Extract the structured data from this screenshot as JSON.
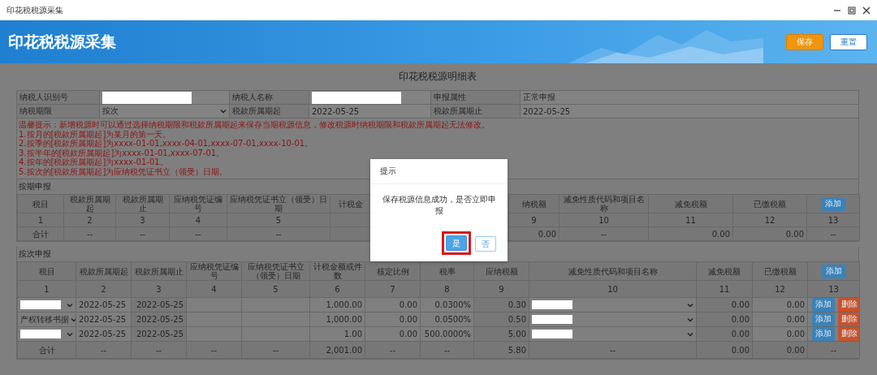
{
  "window": {
    "title": "印花税税源采集"
  },
  "header": {
    "title": "印花税税源采集",
    "buttons": [
      {
        "label": "保存",
        "kind": "primary"
      },
      {
        "label": "重置",
        "kind": "secondary"
      }
    ]
  },
  "page_title": "印花税税源明细表",
  "form": {
    "rows": [
      [
        {
          "label": "纳税人识别号",
          "kind": "input"
        },
        {
          "label": "纳税人名称",
          "kind": "input"
        },
        {
          "label": "申报属性",
          "kind": "text",
          "value": "正常申报"
        }
      ],
      [
        {
          "label": "纳税期限",
          "kind": "select",
          "value": "按次"
        },
        {
          "label": "税款所属期起",
          "kind": "text",
          "value": "2022-05-25"
        },
        {
          "label": "税款所属期止",
          "kind": "text",
          "value": "2022-05-25"
        }
      ]
    ]
  },
  "notice": [
    "温馨提示：新增税源时可以通过选择纳税期限和税款所属期起来保存当期税源信息，修改税源时纳税期限和税款所属期起无法修改。",
    "1.按月的[税款所属期起]为某月的第一天。",
    "2.按季的[税款所属期起]为xxxx-01-01,xxxx-04-01,xxxx-07-01,xxxx-10-01。",
    "3.按半年的[税款所属期起]为xxxx-01-01,xxxx-07-01。",
    "4.按年的[税款所属期起]为xxxx-01-01。",
    "5.按次的[税款所属期起]为应纳税凭证书立（领受）日期。"
  ],
  "periodic_table": {
    "title": "按期申报",
    "header": [
      {
        "kind": "text",
        "text": "税目"
      },
      {
        "kind": "text",
        "text": "税款所属期起"
      },
      {
        "kind": "text",
        "text": "税款所属期止"
      },
      {
        "kind": "text",
        "text": "应纳税凭证编号"
      },
      {
        "kind": "text",
        "text": "应纳税凭证书立（领受）日期"
      },
      {
        "kind": "text",
        "text": "计税金"
      },
      {
        "kind": "blank"
      },
      {
        "kind": "blank"
      },
      {
        "kind": "text",
        "text": "纳税额"
      },
      {
        "kind": "text",
        "text": "减免性质代码和项目名称"
      },
      {
        "kind": "text",
        "text": "减免税额"
      },
      {
        "kind": "text",
        "text": "已缴税额"
      },
      {
        "kind": "button",
        "text": "添加"
      }
    ],
    "numbers": [
      {
        "kind": "text",
        "text": "1"
      },
      {
        "kind": "text",
        "text": "2"
      },
      {
        "kind": "text",
        "text": "3"
      },
      {
        "kind": "text",
        "text": "4"
      },
      {
        "kind": "text",
        "text": "5"
      },
      {
        "kind": "blank"
      },
      {
        "kind": "blank"
      },
      {
        "kind": "blank"
      },
      {
        "kind": "text",
        "text": "9"
      },
      {
        "kind": "text",
        "text": "10"
      },
      {
        "kind": "text",
        "text": "11"
      },
      {
        "kind": "text",
        "text": "12"
      },
      {
        "kind": "text",
        "text": "13"
      }
    ],
    "total": [
      {
        "kind": "text",
        "text": "合计"
      },
      {
        "kind": "text",
        "text": "--"
      },
      {
        "kind": "text",
        "text": "--"
      },
      {
        "kind": "text",
        "text": "--"
      },
      {
        "kind": "text",
        "text": "--"
      },
      {
        "kind": "blank"
      },
      {
        "kind": "blank"
      },
      {
        "kind": "blank"
      },
      {
        "kind": "text",
        "text": "0.00"
      },
      {
        "kind": "text",
        "text": "--"
      },
      {
        "kind": "text",
        "text": "0.00"
      },
      {
        "kind": "text",
        "text": "0.00"
      },
      {
        "kind": "text",
        "text": "--"
      }
    ]
  },
  "per_time_table": {
    "title": "按次申报",
    "header": [
      {
        "kind": "text",
        "text": "税目"
      },
      {
        "kind": "text",
        "text": "税款所属期起"
      },
      {
        "kind": "text",
        "text": "税款所属期止"
      },
      {
        "kind": "text",
        "text": "应纳税凭证编号"
      },
      {
        "kind": "text",
        "text": "应纳税凭证书立（领受）日期"
      },
      {
        "kind": "text",
        "text": "计税金额或件数"
      },
      {
        "kind": "text",
        "text": "核定比例"
      },
      {
        "kind": "text",
        "text": "税率"
      },
      {
        "kind": "text",
        "text": "应纳税额"
      },
      {
        "kind": "text",
        "text": "减免性质代码和项目名称"
      },
      {
        "kind": "text",
        "text": "减免税额"
      },
      {
        "kind": "text",
        "text": "已缴税额"
      },
      {
        "kind": "button",
        "text": "添加"
      }
    ],
    "numbers": [
      "1",
      "2",
      "3",
      "4",
      "5",
      "6",
      "7",
      "8",
      "9",
      "10",
      "11",
      "12",
      "13"
    ],
    "rows": [
      [
        {
          "kind": "select"
        },
        {
          "kind": "text",
          "text": "2022-05-25"
        },
        {
          "kind": "text",
          "text": "2022-05-25"
        },
        {
          "kind": "blank"
        },
        {
          "kind": "blank"
        },
        {
          "kind": "text",
          "text": "1,000.00"
        },
        {
          "kind": "text",
          "text": "0.00"
        },
        {
          "kind": "text",
          "text": "0.0300%"
        },
        {
          "kind": "text",
          "text": "0.30"
        },
        {
          "kind": "select"
        },
        {
          "kind": "text",
          "text": "0.00"
        },
        {
          "kind": "text",
          "text": "0.00"
        },
        {
          "kind": "actions",
          "buttons": [
            "添加",
            "删除"
          ]
        }
      ],
      [
        {
          "kind": "select",
          "value": "产权转移书据"
        },
        {
          "kind": "text",
          "text": "2022-05-25"
        },
        {
          "kind": "text",
          "text": "2022-05-25"
        },
        {
          "kind": "blank"
        },
        {
          "kind": "blank"
        },
        {
          "kind": "text",
          "text": "1,000.00"
        },
        {
          "kind": "text",
          "text": "0.00"
        },
        {
          "kind": "text",
          "text": "0.0500%"
        },
        {
          "kind": "text",
          "text": "0.50"
        },
        {
          "kind": "select"
        },
        {
          "kind": "text",
          "text": "0.00"
        },
        {
          "kind": "text",
          "text": "0.00"
        },
        {
          "kind": "actions",
          "buttons": [
            "添加",
            "删除"
          ]
        }
      ],
      [
        {
          "kind": "select"
        },
        {
          "kind": "text",
          "text": "2022-05-25"
        },
        {
          "kind": "text",
          "text": "2022-05-25"
        },
        {
          "kind": "blank"
        },
        {
          "kind": "blank"
        },
        {
          "kind": "text",
          "text": "1.00"
        },
        {
          "kind": "text",
          "text": "0.00"
        },
        {
          "kind": "text",
          "text": "500.0000%"
        },
        {
          "kind": "text",
          "text": "5.00"
        },
        {
          "kind": "select"
        },
        {
          "kind": "text",
          "text": "0.00"
        },
        {
          "kind": "text",
          "text": "0.00"
        },
        {
          "kind": "actions",
          "buttons": [
            "添加",
            "删除"
          ]
        }
      ]
    ],
    "total": [
      "合计",
      "--",
      "--",
      "--",
      "--",
      "2,001.00",
      "--",
      "--",
      "5.80",
      "--",
      "0.00",
      "0.00",
      "--"
    ]
  },
  "dialog": {
    "title": "提示",
    "message": "保存税源信息成功，是否立即申报",
    "buttons": [
      {
        "label": "是",
        "kind": "primary",
        "highlighted": true
      },
      {
        "label": "否",
        "kind": "secondary",
        "highlighted": false
      }
    ]
  }
}
